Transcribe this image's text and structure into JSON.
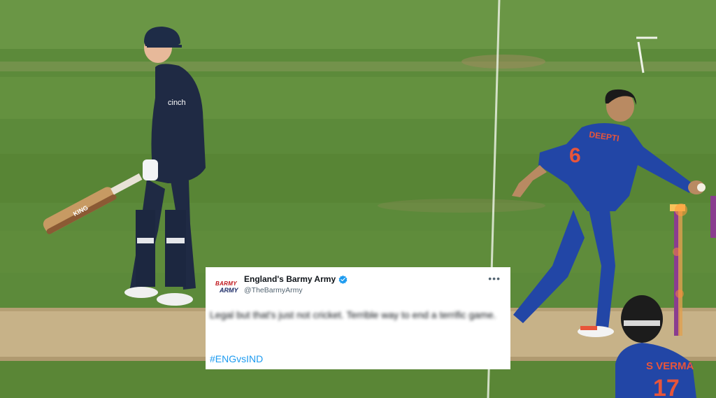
{
  "tweet": {
    "avatar_line1": "BARMY",
    "avatar_line2": "ARMY",
    "display_name": "England's Barmy Army",
    "handle": "@TheBarmyArmy",
    "more_icon": "more-options-icon",
    "text": "Legal but that's just not cricket. Terrible way to end a terrific game.",
    "hashtag": "#ENGvsIND"
  },
  "scene": {
    "batter_logo": "cinch",
    "batter_bat_label": "KING",
    "bowler_name": "DEEPTI",
    "bowler_number": "6",
    "fielder_name": "S VERMA",
    "fielder_number": "17"
  },
  "colors": {
    "grass": "#5f8a3c",
    "pitch": "#c9b48a",
    "england_kit": "#1f2a44",
    "india_kit": "#2147a8",
    "link": "#1d9bf0"
  }
}
